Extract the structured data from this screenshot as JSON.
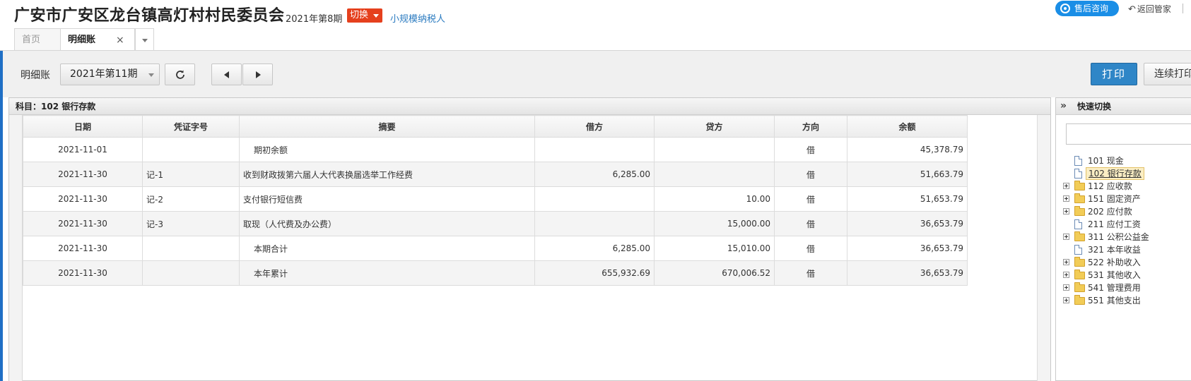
{
  "header": {
    "org_name": "广安市广安区龙台镇高灯村村民委员会",
    "period": "2021年第8期",
    "switch_label": "切换",
    "taxpayer_type": "小规模纳税人",
    "support_label": "售后咨询",
    "back_label": "返回管家"
  },
  "tabs": [
    {
      "label": "首页"
    },
    {
      "label": "明细账",
      "close": "×"
    }
  ],
  "toolbar": {
    "label": "明细账",
    "period_value": "2021年第11期",
    "print_label": "打印",
    "continuous_print_label": "连续打印"
  },
  "ledger": {
    "subject_title": "科目：102 银行存款",
    "columns": [
      "日期",
      "凭证字号",
      "摘要",
      "借方",
      "贷方",
      "方向",
      "余额"
    ],
    "rows": [
      {
        "date": "2021-11-01",
        "voucher": "",
        "summary": "期初余额",
        "debit": "",
        "credit": "",
        "direction": "借",
        "balance": "45,378.79"
      },
      {
        "date": "2021-11-30",
        "voucher": "记-1",
        "summary": "收到财政拨第六届人大代表换届选举工作经费",
        "debit": "6,285.00",
        "credit": "",
        "direction": "借",
        "balance": "51,663.79"
      },
      {
        "date": "2021-11-30",
        "voucher": "记-2",
        "summary": "支付银行短信费",
        "debit": "",
        "credit": "10.00",
        "direction": "借",
        "balance": "51,653.79"
      },
      {
        "date": "2021-11-30",
        "voucher": "记-3",
        "summary": "取现（人代费及办公费）",
        "debit": "",
        "credit": "15,000.00",
        "direction": "借",
        "balance": "36,653.79"
      },
      {
        "date": "2021-11-30",
        "voucher": "",
        "summary": "本期合计",
        "debit": "6,285.00",
        "credit": "15,010.00",
        "direction": "借",
        "balance": "36,653.79"
      },
      {
        "date": "2021-11-30",
        "voucher": "",
        "summary": "本年累计",
        "debit": "655,932.69",
        "credit": "670,006.52",
        "direction": "借",
        "balance": "36,653.79"
      }
    ]
  },
  "quick_switch": {
    "collapse_glyph": "»",
    "title": "快速切换",
    "items": [
      {
        "label": "101 现金",
        "type": "file",
        "expandable": false,
        "selected": false
      },
      {
        "label": "102 银行存款",
        "type": "file",
        "expandable": false,
        "selected": true
      },
      {
        "label": "112 应收款",
        "type": "folder",
        "expandable": true,
        "selected": false
      },
      {
        "label": "151 固定资产",
        "type": "folder",
        "expandable": true,
        "selected": false
      },
      {
        "label": "202 应付款",
        "type": "folder",
        "expandable": true,
        "selected": false
      },
      {
        "label": "211 应付工资",
        "type": "file",
        "expandable": false,
        "selected": false
      },
      {
        "label": "311 公积公益金",
        "type": "folder",
        "expandable": true,
        "selected": false
      },
      {
        "label": "321 本年收益",
        "type": "file",
        "expandable": false,
        "selected": false
      },
      {
        "label": "522 补助收入",
        "type": "folder",
        "expandable": true,
        "selected": false
      },
      {
        "label": "531 其他收入",
        "type": "folder",
        "expandable": true,
        "selected": false
      },
      {
        "label": "541 管理费用",
        "type": "folder",
        "expandable": true,
        "selected": false
      },
      {
        "label": "551 其他支出",
        "type": "folder",
        "expandable": true,
        "selected": false
      }
    ]
  },
  "colors": {
    "accent_blue": "#2f86c7",
    "switch_red": "#e5401d",
    "link_blue": "#2b7bc0",
    "support_blue": "#1a8ee6",
    "selection_bg": "#fbeec4"
  }
}
